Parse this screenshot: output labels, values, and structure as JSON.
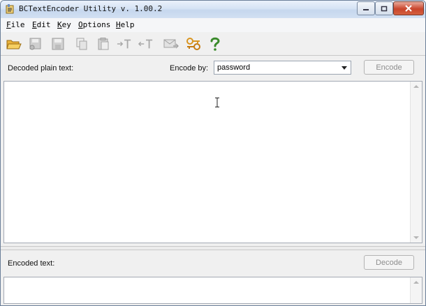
{
  "window": {
    "title": "BCTextEncoder Utility v. 1.00.2"
  },
  "menu": [
    {
      "label_u": "F",
      "label_rest": "ile"
    },
    {
      "label_u": "E",
      "label_rest": "dit"
    },
    {
      "label_u": "K",
      "label_rest": "ey"
    },
    {
      "label_u": "O",
      "label_rest": "ptions"
    },
    {
      "label_u": "H",
      "label_rest": "elp"
    }
  ],
  "toolbar": {
    "icons": [
      "open-folder-icon",
      "save-key-icon",
      "save-icon",
      "copy-icon",
      "paste-icon",
      "encode-text-icon",
      "decode-text-icon",
      "email-icon",
      "keys-icon",
      "help-icon"
    ]
  },
  "top": {
    "decoded_label": "Decoded plain text:",
    "encode_by_label": "Encode by:",
    "encode_by_value": "password",
    "encode_button": "Encode"
  },
  "bottom": {
    "encoded_label": "Encoded text:",
    "decode_button": "Decode"
  },
  "colors": {
    "help": "#3a8a2a",
    "folder": "#e7a72a",
    "disabled": "#a9a9a9"
  }
}
